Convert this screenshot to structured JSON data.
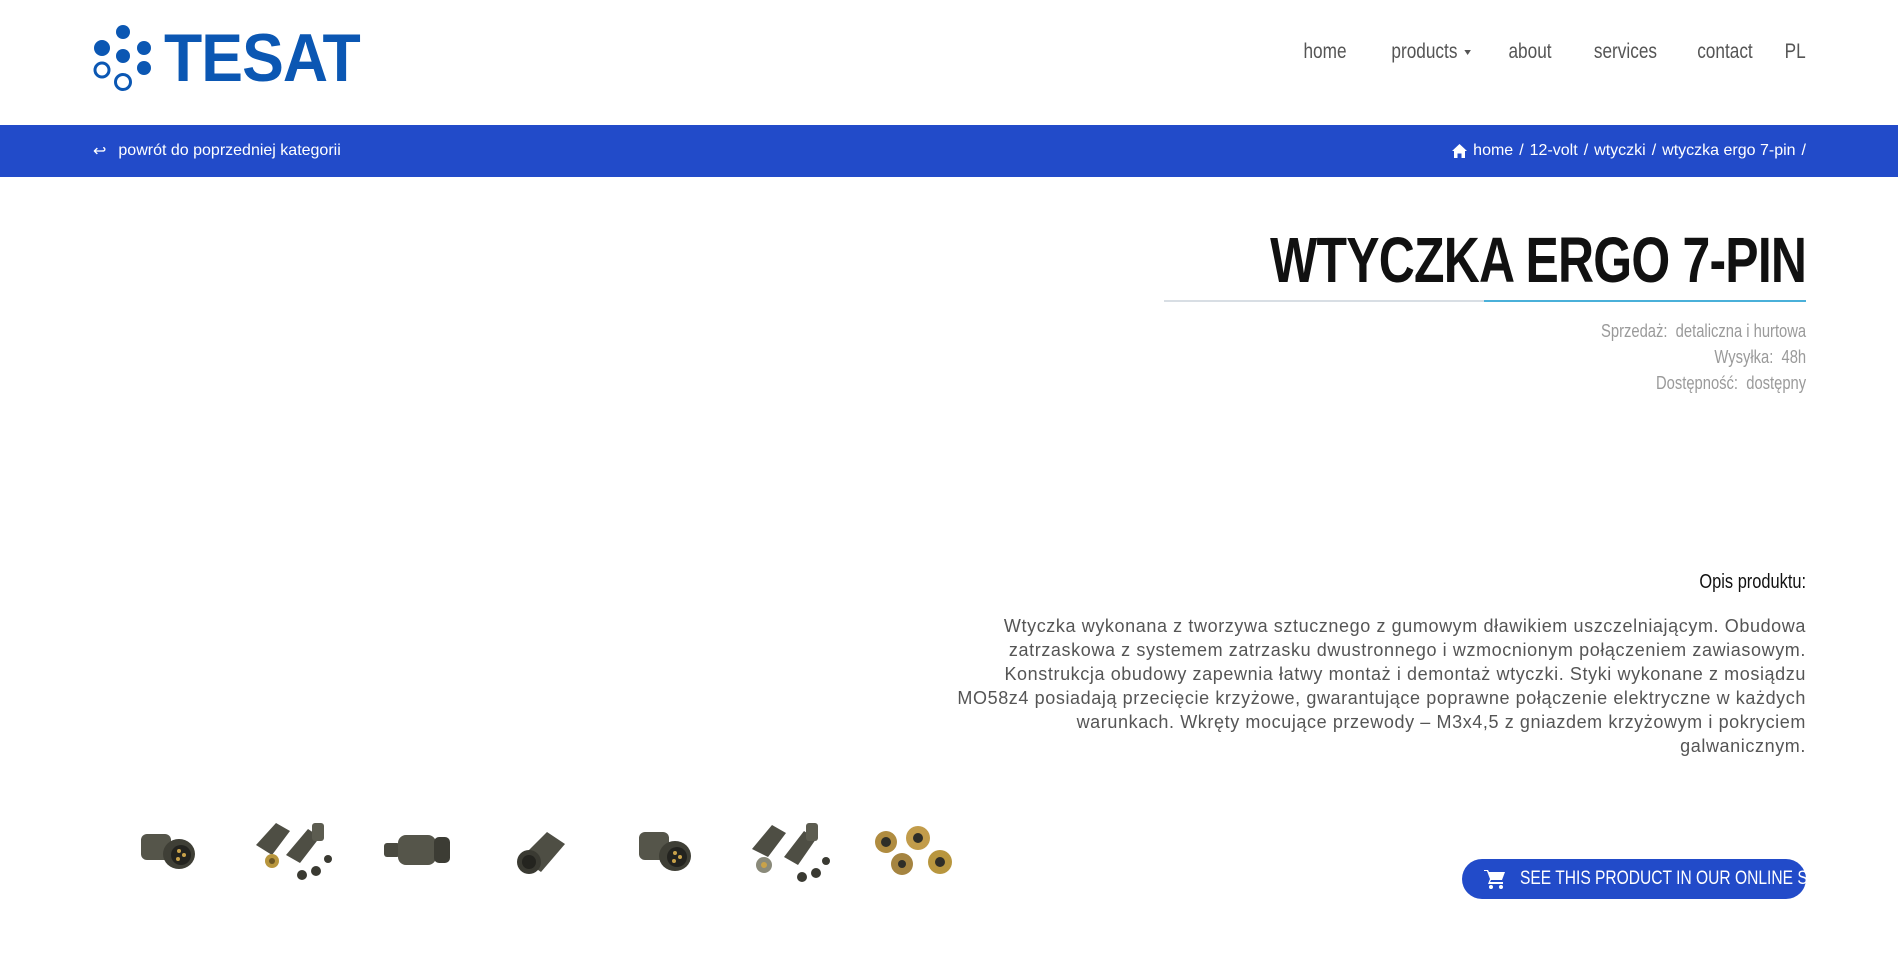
{
  "header": {
    "logo_text": "TESAT",
    "nav": [
      {
        "label": "home"
      },
      {
        "label": "products"
      },
      {
        "label": "about"
      },
      {
        "label": "services"
      },
      {
        "label": "contact"
      },
      {
        "label": "PL"
      }
    ]
  },
  "bar": {
    "back_label": "powrót do poprzedniej kategorii",
    "breadcrumb": [
      "home",
      "12-volt",
      "wtyczki",
      "wtyczka ergo 7-pin"
    ],
    "separator": "/"
  },
  "product": {
    "title": "WTYCZKA ERGO 7-PIN",
    "meta": [
      {
        "label": "Sprzedaż:",
        "value": "detaliczna i hurtowa"
      },
      {
        "label": "Wysyłka:",
        "value": "48h"
      },
      {
        "label": "Dostępność:",
        "value": "dostępny"
      }
    ],
    "description_heading": "Opis produktu:",
    "description": "Wtyczka wykonana z tworzywa sztucznego z gumowym dławikiem uszczelniającym. Obudowa zatrzaskowa z systemem zatrzasku dwustronnego i wzmocnionym połączeniem zawiasowym. Konstrukcja obudowy zapewnia łatwy montaż i demontaż wtyczki. Styki wykonane z mosiądzu MO58z4 posiadają przecięcie krzyżowe, gwarantujące poprawne połączenie elektryczne w każdych warunkach. Wkręty mocujące przewody – M3x4,5 z gniazdem krzyżowym i pokryciem galwanicznym.",
    "shop_button": "SEE THIS PRODUCT IN OUR ONLINE SHOP",
    "thumbnails": [
      "plug-front",
      "plug-disassembled",
      "plug-side",
      "plug-angled",
      "plug-front-2",
      "plug-parts",
      "contact-pins"
    ]
  },
  "colors": {
    "brand_blue": "#224bc9",
    "logo_blue": "#0b57b3",
    "accent_line": "#4ab0d9"
  }
}
